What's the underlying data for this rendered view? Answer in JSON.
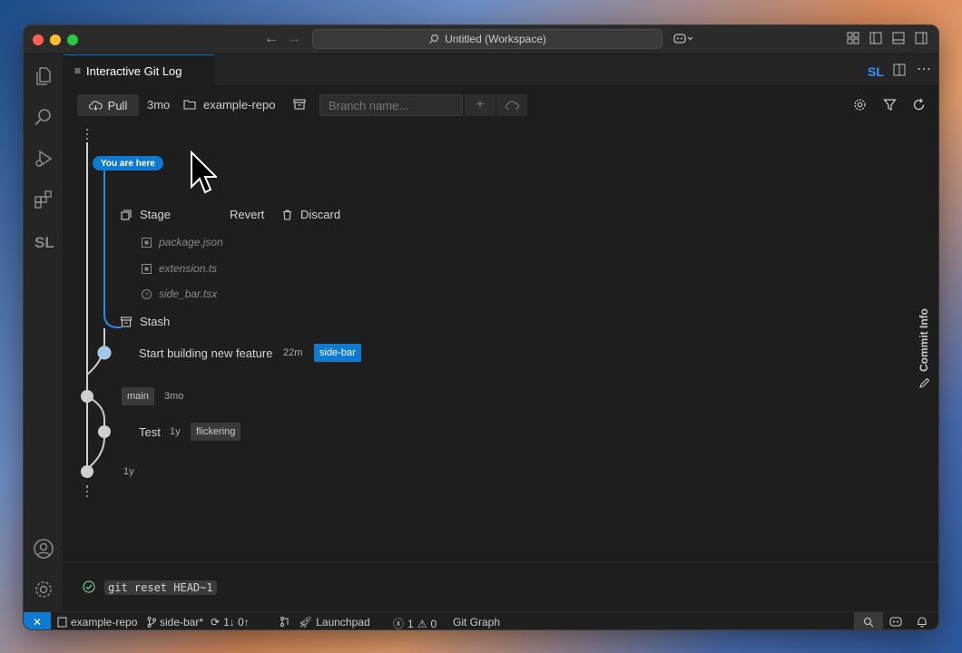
{
  "titlebar": {
    "workspace_title": "Untitled (Workspace)"
  },
  "tab": {
    "label": "Interactive Git Log"
  },
  "toolbar": {
    "pull_label": "Pull",
    "pull_age": "3mo",
    "repo_name": "example-repo",
    "branch_placeholder": "Branch name..."
  },
  "graph": {
    "you_are_here": "You are here",
    "actions": {
      "stage": "Stage",
      "revert": "Revert",
      "discard": "Discard",
      "stash": "Stash"
    },
    "files": [
      {
        "name": "package.json",
        "status": "modified"
      },
      {
        "name": "extension.ts",
        "status": "modified"
      },
      {
        "name": "side_bar.tsx",
        "status": "untracked"
      }
    ],
    "commits": [
      {
        "message": "Start building new feature",
        "age": "22m",
        "tag": "side-bar",
        "tag_style": "active"
      },
      {
        "message": "",
        "age": "3mo",
        "tag": "main",
        "tag_style": "normal"
      },
      {
        "message": "Test",
        "age": "1y",
        "tag": "flickering",
        "tag_style": "normal"
      },
      {
        "message": "",
        "age": "1y",
        "tag": "",
        "tag_style": ""
      }
    ]
  },
  "commit_info": {
    "label": "Commit Info"
  },
  "panel": {
    "last_command": "git reset HEAD~1"
  },
  "statusbar": {
    "repo": "example-repo",
    "branch": "side-bar*",
    "sync": "1↓ 0↑",
    "launchpad": "Launchpad",
    "errors": "1",
    "warnings": "0",
    "git_graph": "Git Graph"
  },
  "colors": {
    "accent": "#0e7ad1",
    "editor_bg": "#1e1e1e",
    "graph_line": "#cfcfcf"
  }
}
